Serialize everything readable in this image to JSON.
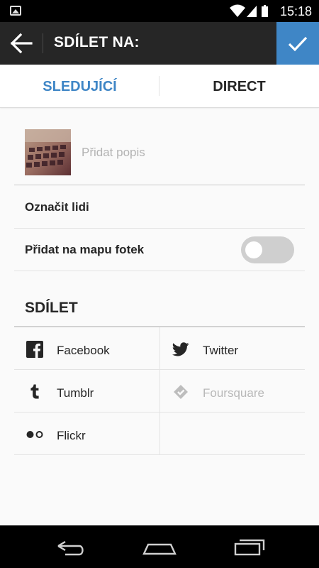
{
  "status_bar": {
    "time": "15:18"
  },
  "app_bar": {
    "title": "SDÍLET NA:"
  },
  "tabs": [
    {
      "label": "SLEDUJÍCÍ",
      "active": true
    },
    {
      "label": "DIRECT",
      "active": false
    }
  ],
  "caption": {
    "placeholder": "Přidat popis",
    "value": ""
  },
  "tag_people": {
    "label": "Označit lidi"
  },
  "photo_map": {
    "label": "Přidat na mapu fotek",
    "enabled": false
  },
  "share": {
    "heading": "SDÍLET",
    "services": [
      {
        "label": "Facebook",
        "icon": "facebook-icon",
        "enabled": true
      },
      {
        "label": "Twitter",
        "icon": "twitter-icon",
        "enabled": true
      },
      {
        "label": "Tumblr",
        "icon": "tumblr-icon",
        "enabled": true
      },
      {
        "label": "Foursquare",
        "icon": "foursquare-icon",
        "enabled": false
      },
      {
        "label": "Flickr",
        "icon": "flickr-icon",
        "enabled": true
      }
    ]
  },
  "colors": {
    "accent": "#3f86c6",
    "app_bar": "#262626",
    "text": "#262626",
    "placeholder": "#b3b3b3"
  }
}
